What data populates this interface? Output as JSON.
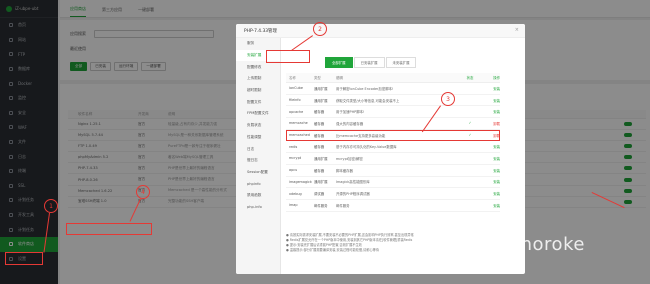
{
  "sidebar": {
    "host": "iZ-ubpe-ubt",
    "items": [
      "首页",
      "网站",
      "FTP",
      "数据库",
      "Docker",
      "监控",
      "安全",
      "WAF",
      "文件",
      "日志",
      "终端",
      "SSL",
      "计划任务",
      "开发工具",
      "计划任务",
      "软件商店",
      "设置"
    ],
    "active_index": 15
  },
  "topbar": {
    "tabs": [
      "应用商店",
      "第三方应用",
      "一键部署"
    ],
    "active": 0
  },
  "store": {
    "filter_label": "应用搜索",
    "sort_label": "最近使用",
    "buttons": [
      "全部",
      "已安装",
      "运行环境",
      "一键部署"
    ]
  },
  "app_table": {
    "headers": [
      "软件名称",
      "开发商",
      "说明",
      "价格",
      "位置",
      "状态",
      "首页显示",
      "操作"
    ],
    "rows": [
      {
        "name": "Nginx 1.25.1",
        "dev": "官方",
        "desc": "轻量级,占有内存少,并发能力强",
        "price": "免费"
      },
      {
        "name": "MySQL 5.7.44",
        "dev": "官方",
        "desc": "MySQL是一种关系数据库管理系统",
        "price": "免费"
      },
      {
        "name": "FTP 1.0.49",
        "dev": "官方",
        "desc": "PureFTPd是一款专注于程序健壮",
        "price": "免费"
      },
      {
        "name": "phpMyAdmin 5.2",
        "dev": "官方",
        "desc": "著名Web端MySQL管理工具",
        "price": "免费"
      },
      {
        "name": "PHP-7.4.33",
        "dev": "官方",
        "desc": "PHP是世界上最好的编程语言",
        "price": "免费"
      },
      {
        "name": "PHP-8.0.26",
        "dev": "官方",
        "desc": "PHP是世界上最好的编程语言",
        "price": "免费"
      },
      {
        "name": "Memcached 1.6.22",
        "dev": "官方",
        "desc": "Memcached 是一个高性能的分布式",
        "price": "免费"
      },
      {
        "name": "宝塔SSH终端 1.0",
        "dev": "官方",
        "desc": "完整功能的SSH客户端",
        "price": "免费"
      }
    ]
  },
  "dialog": {
    "title": "PHP-7.4.33管理",
    "close": "×",
    "nav": [
      "服务",
      "安装扩展",
      "配置修改",
      "上传限制",
      "超时限制",
      "配置文件",
      "FPM配置文件",
      "负载状态",
      "性能调整",
      "日志",
      "慢日志",
      "Session配置",
      "phpinfo",
      "禁用函数",
      "php-info"
    ],
    "nav_selected": 1,
    "tabs": [
      "全部扩展",
      "已安装扩展",
      "未安装扩展"
    ],
    "tab_selected": 0,
    "table_headers": {
      "name": "名称",
      "type": "类型",
      "desc": "说明",
      "status": "状态",
      "op": "操作"
    },
    "extensions": [
      {
        "name": "ionCube",
        "type": "通用扩展",
        "desc": "用于解密ionCube Encoder加密脚本!",
        "status": "",
        "op": "安装"
      },
      {
        "name": "fileinfo",
        "type": "通用扩展",
        "desc": "获取文件类型/大小等信息,可能会安装不上",
        "status": "",
        "op": "安装"
      },
      {
        "name": "opcache",
        "type": "缓存器",
        "desc": "用于加速PHP脚本!",
        "status": "",
        "op": "安装"
      },
      {
        "name": "memcache",
        "type": "缓存器",
        "desc": "强大的内容缓存器",
        "status": "✓",
        "op": "卸载"
      },
      {
        "name": "memcached",
        "type": "缓存器",
        "desc": "比memcache支持更多高级功能",
        "status": "✓",
        "op": "卸载"
      },
      {
        "name": "redis",
        "type": "缓存器",
        "desc": "基于内存亦可持久化的Key-Value数据库",
        "status": "",
        "op": "安装"
      },
      {
        "name": "mcrypt",
        "type": "通用扩展",
        "desc": "mcrypt加密/解密",
        "status": "",
        "op": "安装"
      },
      {
        "name": "apcu",
        "type": "缓存器",
        "desc": "脚本缓存器",
        "status": "",
        "op": "安装"
      },
      {
        "name": "imagemagick",
        "type": "通用扩展",
        "desc": "Imagick高性能图形库",
        "status": "",
        "op": "安装"
      },
      {
        "name": "xdebug",
        "type": "调试器",
        "desc": "开源的PHP程序调试器",
        "status": "",
        "op": "安装"
      },
      {
        "name": "imap",
        "type": "邮件服务",
        "desc": "邮件服务",
        "status": "",
        "op": "安装"
      }
    ],
    "notes": [
      "● 请按实际需求安装扩展,不要安装不必要的PHP扩展,这会影响PHP执行效率,甚至出现异常",
      "● Redis扩展仅允许在一个PHP版本中使用,安装到其它PHP版本请在[软件管理]重装Redis",
      "● 提示:安装完扩展后请重载PHP配置,否则扩展不生效",
      "● 温馨提示:部分扩展需要编译安装,安装过程可能较慢,请耐心等待"
    ]
  },
  "markers": [
    "1",
    "2",
    "3",
    "4"
  ],
  "watermark": "@moroke",
  "colors": {
    "accent": "#20a53a",
    "annotation": "#e53935",
    "sidebar": "#2b2e33"
  }
}
